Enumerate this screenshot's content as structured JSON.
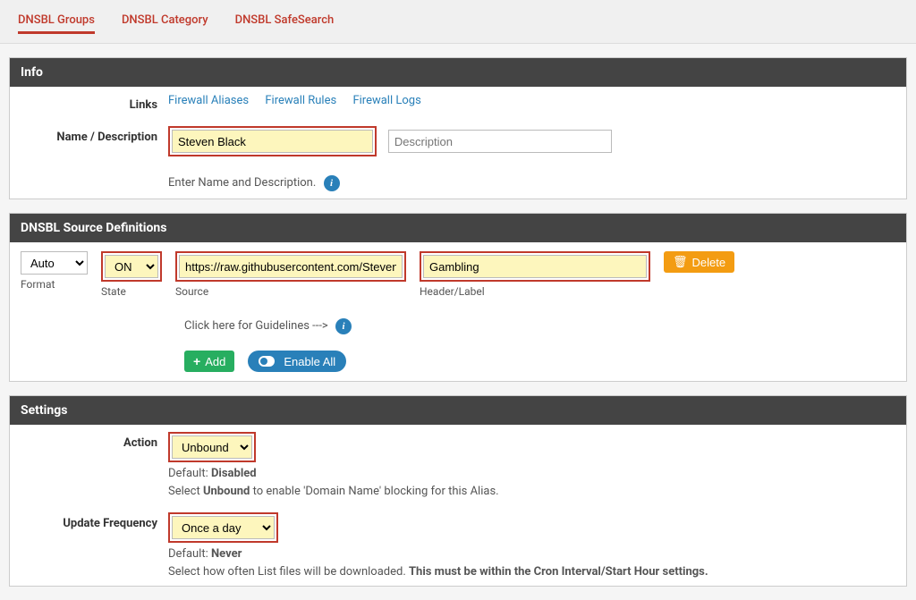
{
  "tabs": {
    "groups": "DNSBL Groups",
    "category": "DNSBL Category",
    "safesearch": "DNSBL SafeSearch"
  },
  "info": {
    "header": "Info",
    "links_label": "Links",
    "link_aliases": "Firewall Aliases",
    "link_rules": "Firewall Rules",
    "link_logs": "Firewall Logs",
    "name_desc_label": "Name / Description",
    "name_value": "Steven Black",
    "desc_placeholder": "Description",
    "help_text": "Enter Name and Description."
  },
  "source_defs": {
    "header": "DNSBL Source Definitions",
    "format_value": "Auto",
    "format_label": "Format",
    "state_value": "ON",
    "state_label": "State",
    "source_value": "https://raw.githubusercontent.com/StevenBlack/hosts/master/alternat",
    "source_label": "Source",
    "header_value": "Gambling",
    "header_label": "Header/Label",
    "delete_label": "Delete",
    "guidelines_text": "Click here for Guidelines --->",
    "add_label": "Add",
    "enable_all_label": "Enable All"
  },
  "settings": {
    "header": "Settings",
    "action_label": "Action",
    "action_value": "Unbound",
    "action_default": "Default: ",
    "action_default_val": "Disabled",
    "action_help_1": "Select ",
    "action_help_2": "Unbound",
    "action_help_3": " to enable 'Domain Name' blocking for this Alias.",
    "update_label": "Update Frequency",
    "update_value": "Once a day",
    "update_default": "Default: ",
    "update_default_val": "Never",
    "update_help_1": "Select how often List files will be downloaded. ",
    "update_help_2": "This must be within the Cron Interval/Start Hour settings."
  }
}
